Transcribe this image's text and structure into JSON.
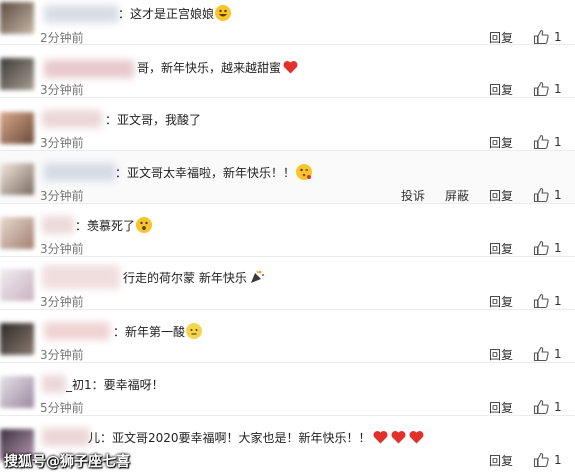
{
  "comments": [
    {
      "text": "：这才是正宫娘娘",
      "time": "2分钟前",
      "reply": "回复",
      "likes": "1",
      "emoji": "grinning-face-icon"
    },
    {
      "text": "哥，新年快乐，越来越甜蜜",
      "time": "3分钟前",
      "reply": "回复",
      "likes": "1",
      "emoji": "red-heart-icon"
    },
    {
      "text": "：亚文哥，我酸了",
      "time": "3分钟前",
      "reply": "回复",
      "likes": "1"
    },
    {
      "text": "：亚文哥太幸福啦，新年快乐！！",
      "time": "3分钟前",
      "reply": "回复",
      "likes": "1",
      "report": "投诉",
      "block": "屏蔽",
      "emoji": "kissing-face-icon"
    },
    {
      "text": "：羡慕死了",
      "time": "3分钟前",
      "reply": "回复",
      "likes": "1",
      "emoji": "astonished-face-icon"
    },
    {
      "text": "行走的荷尔蒙 新年快乐",
      "time": "3分钟前",
      "reply": "回复",
      "likes": "1",
      "emoji": "party-popper-icon"
    },
    {
      "text": "：新年第一酸",
      "time": "3分钟前",
      "reply": "回复",
      "likes": "1",
      "emoji": "lemon-face-icon"
    },
    {
      "text": "_初1：要幸福呀！",
      "time": "5分钟前",
      "reply": "回复",
      "likes": "1"
    },
    {
      "text": "儿：亚文哥2020要幸福啊！大家也是！新年快乐！！",
      "time": "",
      "reply": "回复",
      "likes": "1",
      "emoji": "three-red-hearts-icon"
    }
  ],
  "watermark": "搜狐号@狮子座七喜",
  "colors": {
    "heart": "#e0322b",
    "emoji": "#f7c52c",
    "divider": "#ececec"
  }
}
